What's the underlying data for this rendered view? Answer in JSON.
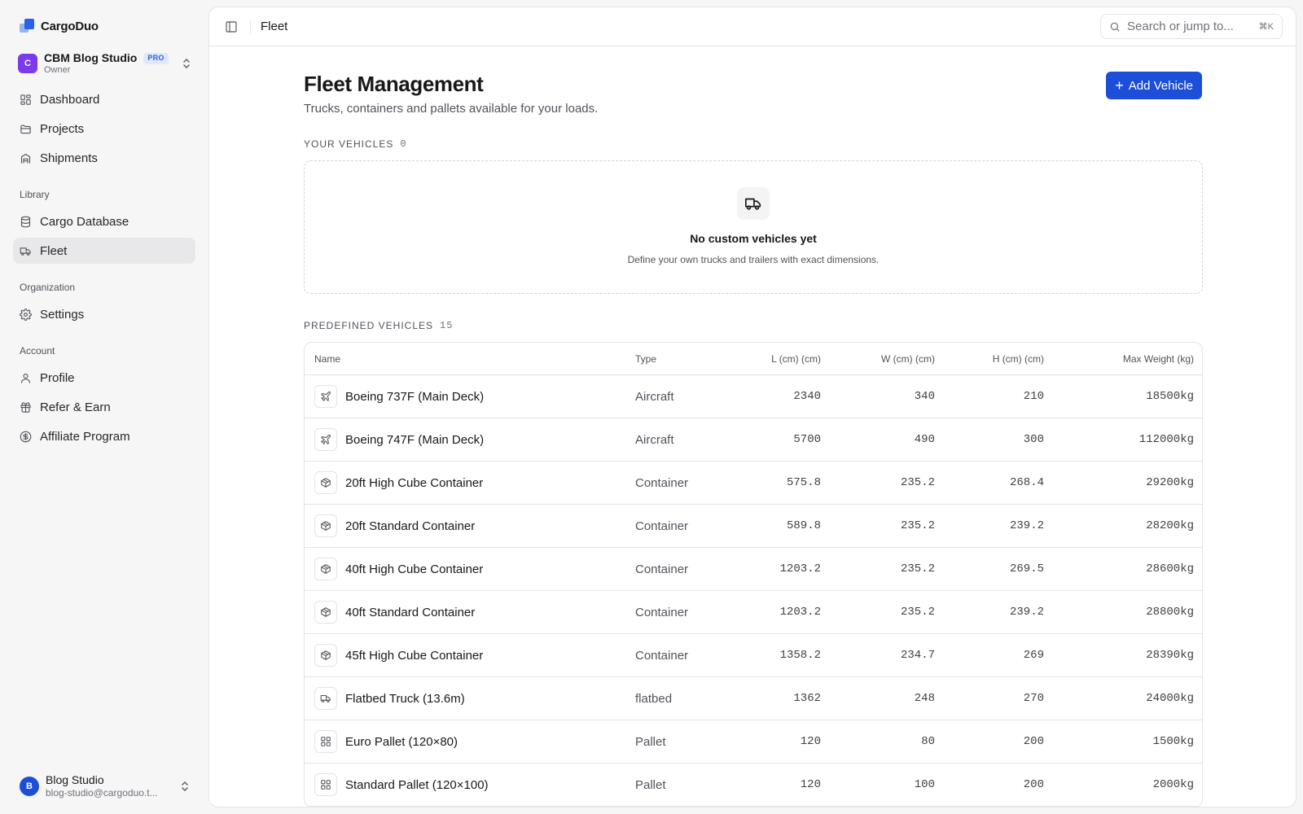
{
  "brand": {
    "name": "CargoDuo"
  },
  "org": {
    "avatar": "C",
    "name": "CBM Blog Studio",
    "badge": "PRO",
    "role": "Owner"
  },
  "nav": {
    "main": [
      {
        "label": "Dashboard",
        "icon": "dashboard-icon"
      },
      {
        "label": "Projects",
        "icon": "folder-icon"
      },
      {
        "label": "Shipments",
        "icon": "shipments-icon"
      }
    ],
    "library_title": "Library",
    "library": [
      {
        "label": "Cargo Database",
        "icon": "database-icon"
      },
      {
        "label": "Fleet",
        "icon": "truck-icon",
        "active": true
      }
    ],
    "organization_title": "Organization",
    "organization": [
      {
        "label": "Settings",
        "icon": "gear-icon"
      }
    ],
    "account_title": "Account",
    "account": [
      {
        "label": "Profile",
        "icon": "user-icon"
      },
      {
        "label": "Refer & Earn",
        "icon": "gift-icon"
      },
      {
        "label": "Affiliate Program",
        "icon": "dollar-icon"
      }
    ]
  },
  "user": {
    "avatar": "B",
    "name": "Blog Studio",
    "email": "blog-studio@cargoduo.t..."
  },
  "topbar": {
    "breadcrumb": "Fleet",
    "search_placeholder": "Search or jump to...",
    "shortcut": "⌘K"
  },
  "page": {
    "title": "Fleet Management",
    "subtitle": "Trucks, containers and pallets available for your loads.",
    "add_button": "Add Vehicle"
  },
  "your_vehicles": {
    "label": "YOUR VEHICLES",
    "count": "0",
    "empty_title": "No custom vehicles yet",
    "empty_desc": "Define your own trucks and trailers with exact dimensions."
  },
  "predefined": {
    "label": "PREDEFINED VEHICLES",
    "count": "15",
    "columns": [
      "Name",
      "Type",
      "L (cm) (cm)",
      "W (cm) (cm)",
      "H (cm) (cm)",
      "Max Weight (kg)"
    ],
    "rows": [
      {
        "icon": "plane-icon",
        "name": "Boeing 737F (Main Deck)",
        "type": "Aircraft",
        "l": "2340",
        "w": "340",
        "h": "210",
        "weight": "18500kg"
      },
      {
        "icon": "plane-icon",
        "name": "Boeing 747F (Main Deck)",
        "type": "Aircraft",
        "l": "5700",
        "w": "490",
        "h": "300",
        "weight": "112000kg"
      },
      {
        "icon": "container-icon",
        "name": "20ft High Cube Container",
        "type": "Container",
        "l": "575.8",
        "w": "235.2",
        "h": "268.4",
        "weight": "29200kg"
      },
      {
        "icon": "container-icon",
        "name": "20ft Standard Container",
        "type": "Container",
        "l": "589.8",
        "w": "235.2",
        "h": "239.2",
        "weight": "28200kg"
      },
      {
        "icon": "container-icon",
        "name": "40ft High Cube Container",
        "type": "Container",
        "l": "1203.2",
        "w": "235.2",
        "h": "269.5",
        "weight": "28600kg"
      },
      {
        "icon": "container-icon",
        "name": "40ft Standard Container",
        "type": "Container",
        "l": "1203.2",
        "w": "235.2",
        "h": "239.2",
        "weight": "28800kg"
      },
      {
        "icon": "container-icon",
        "name": "45ft High Cube Container",
        "type": "Container",
        "l": "1358.2",
        "w": "234.7",
        "h": "269",
        "weight": "28390kg"
      },
      {
        "icon": "truck-icon",
        "name": "Flatbed Truck (13.6m)",
        "type": "flatbed",
        "l": "1362",
        "w": "248",
        "h": "270",
        "weight": "24000kg"
      },
      {
        "icon": "pallet-icon",
        "name": "Euro Pallet (120×80)",
        "type": "Pallet",
        "l": "120",
        "w": "80",
        "h": "200",
        "weight": "1500kg"
      },
      {
        "icon": "pallet-icon",
        "name": "Standard Pallet (120×100)",
        "type": "Pallet",
        "l": "120",
        "w": "100",
        "h": "200",
        "weight": "2000kg"
      }
    ]
  },
  "colors": {
    "accent": "#1d4ed8",
    "org_avatar": "#7c3aed",
    "active_nav": "#e8e8ea"
  }
}
